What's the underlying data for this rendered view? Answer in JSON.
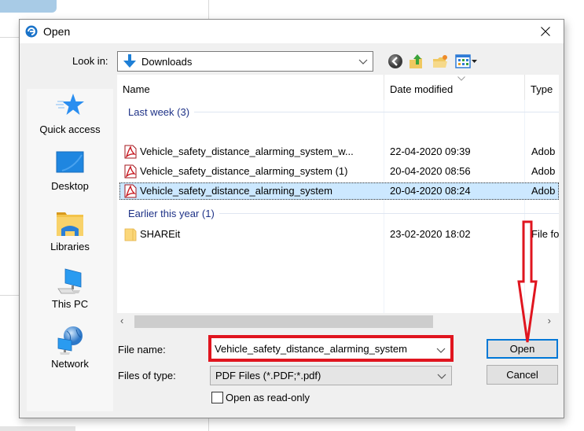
{
  "dialog": {
    "title": "Open",
    "close_label": "Close"
  },
  "lookin": {
    "label": "Look in:",
    "value": "Downloads"
  },
  "toolbar": {
    "icons": [
      "back-icon",
      "up-folder-icon",
      "new-folder-icon",
      "view-menu-icon"
    ]
  },
  "sidebar": {
    "items": [
      {
        "label": "Quick access",
        "icon": "quick-access-star-icon"
      },
      {
        "label": "Desktop",
        "icon": "desktop-icon"
      },
      {
        "label": "Libraries",
        "icon": "libraries-folder-icon"
      },
      {
        "label": "This PC",
        "icon": "this-pc-icon"
      },
      {
        "label": "Network",
        "icon": "network-icon"
      }
    ]
  },
  "filelist": {
    "columns": [
      "Name",
      "Date modified",
      "Type"
    ],
    "groups": [
      {
        "label": "Last week (3)",
        "rows": [
          {
            "name": "Vehicle_safety_distance_alarming_system_w...",
            "date": "22-04-2020 09:39",
            "type": "Adob",
            "icon": "pdf-icon",
            "selected": false
          },
          {
            "name": "Vehicle_safety_distance_alarming_system (1)",
            "date": "20-04-2020 08:56",
            "type": "Adob",
            "icon": "pdf-icon",
            "selected": false
          },
          {
            "name": "Vehicle_safety_distance_alarming_system",
            "date": "20-04-2020 08:24",
            "type": "Adob",
            "icon": "pdf-icon",
            "selected": true
          }
        ]
      },
      {
        "label": "Earlier this year (1)",
        "rows": [
          {
            "name": "SHAREit",
            "date": "23-02-2020 18:02",
            "type": "File fo",
            "icon": "folder-icon",
            "selected": false
          }
        ]
      }
    ]
  },
  "scroll": {
    "left_arrow": "‹",
    "right_arrow": "›"
  },
  "form": {
    "file_name_label": "File name:",
    "file_name_value": "Vehicle_safety_distance_alarming_system",
    "file_type_label": "Files of type:",
    "file_type_value": "PDF Files (*.PDF;*.pdf)",
    "readonly_label": "Open as read-only",
    "readonly_checked": false
  },
  "buttons": {
    "open": "Open",
    "cancel": "Cancel"
  },
  "annotation": {
    "highlight_color": "#e0151f"
  }
}
